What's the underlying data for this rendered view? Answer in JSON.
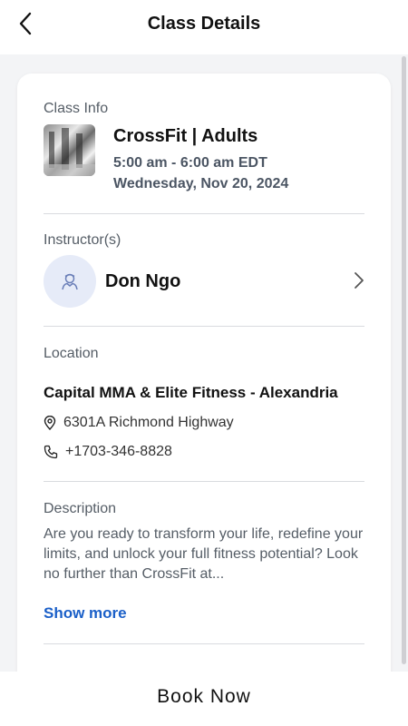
{
  "header": {
    "title": "Class Details"
  },
  "class_info": {
    "label": "Class Info",
    "name": "CrossFit | Adults",
    "time": "5:00 am - 6:00 am EDT",
    "date": "Wednesday, Nov 20, 2024"
  },
  "instructor": {
    "label": "Instructor(s)",
    "name": "Don Ngo"
  },
  "location": {
    "label": "Location",
    "name": "Capital MMA & Elite Fitness - Alexandria",
    "address": "6301A Richmond Highway",
    "phone": "+1703-346-8828"
  },
  "description": {
    "label": "Description",
    "text": "Are you ready to transform your life, redefine your limits, and unlock your full fitness potential? Look no further than CrossFit at...",
    "show_more": "Show more"
  },
  "footer": {
    "book_label": "Book Now"
  },
  "colors": {
    "accent": "#1a5fc8",
    "avatar_bg": "#e6ebf8"
  }
}
